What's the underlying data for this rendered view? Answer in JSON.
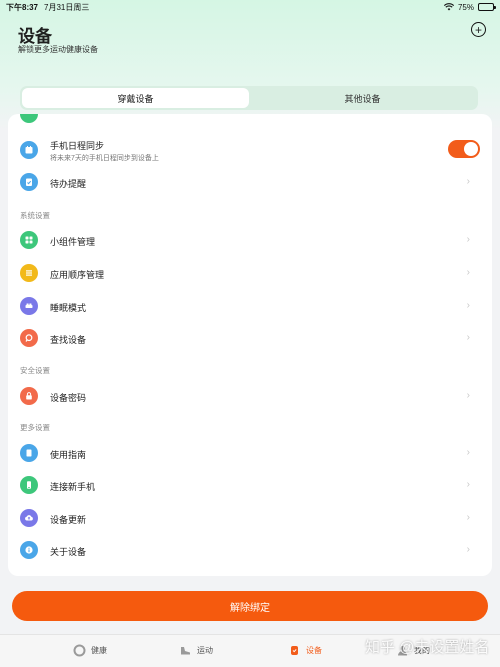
{
  "status_bar": {
    "time": "下午8:37",
    "date": "7月31日周三",
    "battery": "75%",
    "battery_level": 0.75
  },
  "header": {
    "title": "设备",
    "subtitle": "解锁更多运动健康设备"
  },
  "tabs": [
    {
      "label": "穿戴设备",
      "active": true
    },
    {
      "label": "其他设备",
      "active": false
    }
  ],
  "list": {
    "calendar_sync": {
      "label": "手机日程同步",
      "desc": "将未来7天的手机日程同步到设备上",
      "enabled": true
    },
    "todo": {
      "label": "待办提醒"
    },
    "system_header": "系统设置",
    "widgets": {
      "label": "小组件管理"
    },
    "app_order": {
      "label": "应用顺序管理"
    },
    "sleep_mode": {
      "label": "睡眠模式"
    },
    "find_device": {
      "label": "查找设备"
    },
    "security_header": "安全设置",
    "device_password": {
      "label": "设备密码"
    },
    "more_header": "更多设置",
    "guide": {
      "label": "使用指南"
    },
    "connect_phone": {
      "label": "连接新手机"
    },
    "update": {
      "label": "设备更新"
    },
    "about": {
      "label": "关于设备"
    }
  },
  "unbind_label": "解除绑定",
  "nav": [
    {
      "label": "健康",
      "active": false
    },
    {
      "label": "运动",
      "active": false
    },
    {
      "label": "设备",
      "active": true
    },
    {
      "label": "我的",
      "active": false
    }
  ],
  "watermark": "知乎 @未设置姓名",
  "colors": {
    "accent": "#f55a0e",
    "calendar_icon": "#4aa6e8",
    "todo_icon": "#4aa6e8",
    "widgets_icon": "#3dc77b",
    "app_order_icon": "#f2b91a",
    "sleep_icon": "#7a78e8",
    "find_icon": "#f26a4a",
    "password_icon": "#f26a4a",
    "guide_icon": "#4aa6e8",
    "connect_icon": "#3dc77b",
    "update_icon": "#7a78e8",
    "about_icon": "#4aa6e8"
  }
}
